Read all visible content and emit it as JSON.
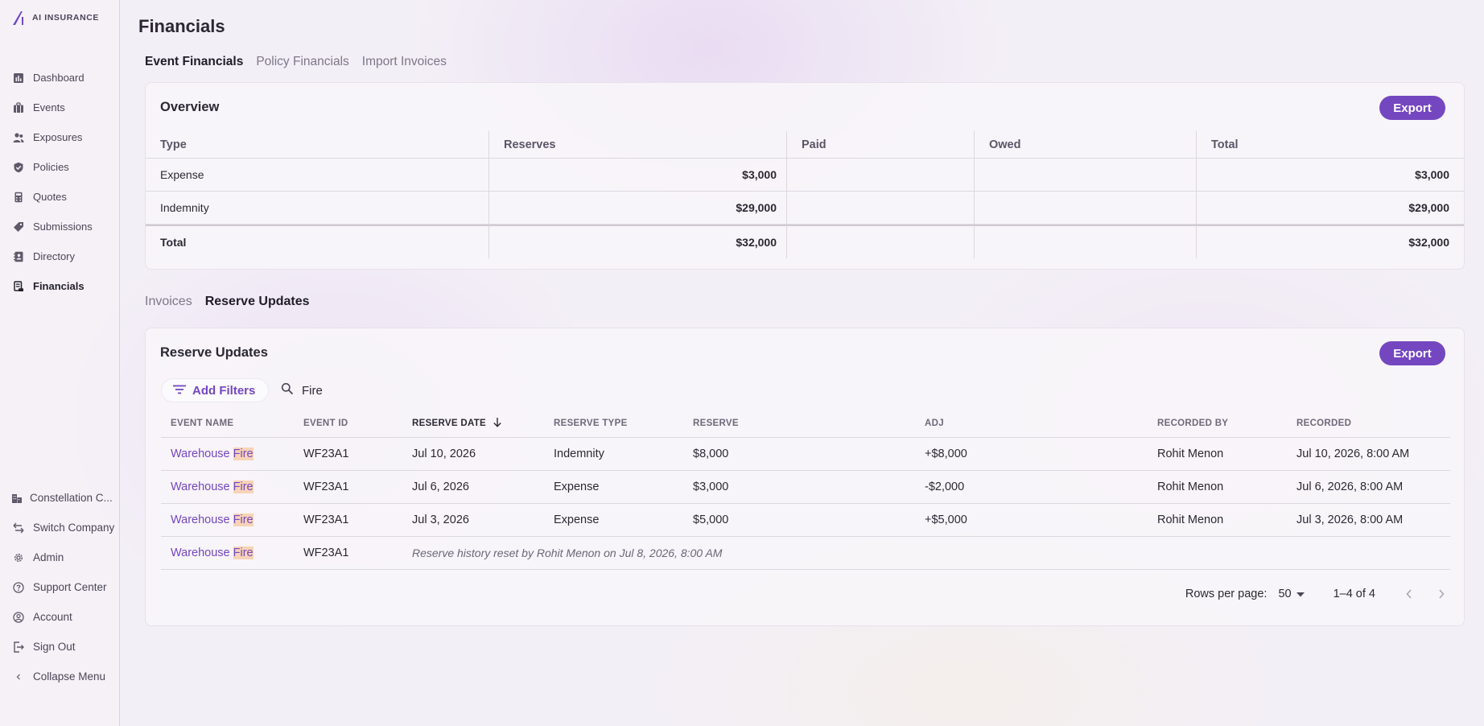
{
  "brand": {
    "name": "AI INSURANCE",
    "accent": "#7447c0"
  },
  "sidebar": {
    "items": [
      {
        "label": "Dashboard",
        "icon": "dashboard-icon"
      },
      {
        "label": "Events",
        "icon": "briefcase-icon"
      },
      {
        "label": "Exposures",
        "icon": "people-icon"
      },
      {
        "label": "Policies",
        "icon": "shield-check-icon"
      },
      {
        "label": "Quotes",
        "icon": "calculator-icon"
      },
      {
        "label": "Submissions",
        "icon": "tag-icon"
      },
      {
        "label": "Directory",
        "icon": "address-book-icon"
      },
      {
        "label": "Financials",
        "icon": "receipt-icon",
        "active": true
      }
    ],
    "bottom": [
      {
        "label": "Constellation C...",
        "icon": "building-icon"
      },
      {
        "label": "Switch Company",
        "icon": "switch-arrows-icon"
      },
      {
        "label": "Admin",
        "icon": "gear-icon"
      },
      {
        "label": "Support Center",
        "icon": "help-circle-icon"
      },
      {
        "label": "Account",
        "icon": "account-circle-icon"
      },
      {
        "label": "Sign Out",
        "icon": "sign-out-icon"
      },
      {
        "label": "Collapse Menu",
        "icon": "chevron-left-icon"
      }
    ]
  },
  "page": {
    "title": "Financials"
  },
  "top_tabs": [
    {
      "label": "Event Financials",
      "active": true
    },
    {
      "label": "Policy Financials"
    },
    {
      "label": "Import Invoices"
    }
  ],
  "overview": {
    "title": "Overview",
    "export_label": "Export",
    "headers": [
      "Type",
      "Reserves",
      "Paid",
      "Owed",
      "Total"
    ],
    "rows": [
      {
        "type": "Expense",
        "reserves": "$3,000",
        "paid": "",
        "owed": "",
        "total": "$3,000"
      },
      {
        "type": "Indemnity",
        "reserves": "$29,000",
        "paid": "",
        "owed": "",
        "total": "$29,000"
      }
    ],
    "total_row": {
      "type": "Total",
      "reserves": "$32,000",
      "paid": "",
      "owed": "",
      "total": "$32,000"
    }
  },
  "mid_tabs": [
    {
      "label": "Invoices"
    },
    {
      "label": "Reserve Updates",
      "active": true
    }
  ],
  "reserve_updates": {
    "title": "Reserve Updates",
    "export_label": "Export",
    "add_filters_label": "Add Filters",
    "search_value": "Fire",
    "headers": [
      "EVENT NAME",
      "EVENT ID",
      "RESERVE DATE",
      "RESERVE TYPE",
      "RESERVE",
      "ADJ",
      "RECORDED BY",
      "RECORDED"
    ],
    "rows": [
      {
        "event_name_prefix": "Warehouse ",
        "event_name_match": "Fire",
        "event_id": "WF23A1",
        "reserve_date": "Jul 10, 2026",
        "reserve_type": "Indemnity",
        "reserve": "$8,000",
        "adj": "+$8,000",
        "recorded_by": "Rohit Menon",
        "recorded": "Jul 10, 2026, 8:00 AM"
      },
      {
        "event_name_prefix": "Warehouse ",
        "event_name_match": "Fire",
        "event_id": "WF23A1",
        "reserve_date": "Jul 6, 2026",
        "reserve_type": "Expense",
        "reserve": "$3,000",
        "adj": "-$2,000",
        "recorded_by": "Rohit Menon",
        "recorded": "Jul 6, 2026, 8:00 AM"
      },
      {
        "event_name_prefix": "Warehouse ",
        "event_name_match": "Fire",
        "event_id": "WF23A1",
        "reserve_date": "Jul 3, 2026",
        "reserve_type": "Expense",
        "reserve": "$5,000",
        "adj": "+$5,000",
        "recorded_by": "Rohit Menon",
        "recorded": "Jul 3, 2026, 8:00 AM"
      }
    ],
    "reset_row": {
      "event_name_prefix": "Warehouse ",
      "event_name_match": "Fire",
      "event_id": "WF23A1",
      "note": "Reserve history reset by Rohit Menon on Jul 8, 2026, 8:00 AM"
    },
    "pagination": {
      "rows_per_page_label": "Rows per page:",
      "rows_per_page": "50",
      "range": "1–4 of 4"
    }
  }
}
